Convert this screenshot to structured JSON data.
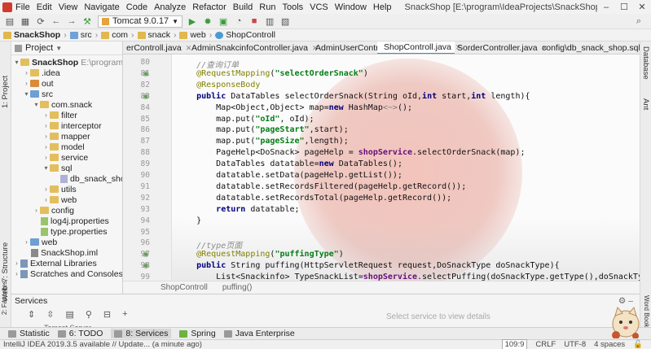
{
  "menubar": {
    "items": [
      "File",
      "Edit",
      "View",
      "Navigate",
      "Code",
      "Analyze",
      "Refactor",
      "Build",
      "Run",
      "Tools",
      "VCS",
      "Window",
      "Help"
    ],
    "title": "SnackShop [E:\\program\\IdeaProjects\\SnackShop] - ...\\src\\com\\snack\\web\\ShopControll.java"
  },
  "toolbar": {
    "run_config": "Tomcat 9.0.17"
  },
  "breadcrumb": [
    "SnackShop",
    "src",
    "com",
    "snack",
    "web",
    "ShopControll"
  ],
  "left_strip": {
    "project": "1: Project",
    "structure": "7: Structure",
    "web": "Web",
    "favorites": "2: Favorites"
  },
  "right_strip": {
    "database": "Database",
    "ant": "Ant",
    "word_book": "Word Book"
  },
  "project_panel": {
    "header": "Project",
    "tree": [
      {
        "label": "SnackShop",
        "suffix": "E:\\program\\IdeaProj"
      },
      {
        "label": ".idea"
      },
      {
        "label": "out"
      },
      {
        "label": "src"
      },
      {
        "label": "com.snack"
      },
      {
        "label": "filter"
      },
      {
        "label": "interceptor"
      },
      {
        "label": "mapper"
      },
      {
        "label": "model"
      },
      {
        "label": "service"
      },
      {
        "label": "sql"
      },
      {
        "label": "db_snack_shop.sql"
      },
      {
        "label": "utils"
      },
      {
        "label": "web"
      },
      {
        "label": "config"
      },
      {
        "label": "log4j.properties"
      },
      {
        "label": "type.properties"
      },
      {
        "label": "web"
      },
      {
        "label": "SnackShop.iml"
      },
      {
        "label": "External Libraries"
      },
      {
        "label": "Scratches and Consoles"
      }
    ]
  },
  "tabs": [
    {
      "label": "erControll.java"
    },
    {
      "label": "AdminSnakcinfoController.java"
    },
    {
      "label": "AdminUserControll.java"
    },
    {
      "label": "ShopControll.java"
    },
    {
      "label": "SorderController.java"
    },
    {
      "label": "config\\db_snack_shop.sql"
    }
  ],
  "editor": {
    "line_numbers": [
      "80",
      "81",
      "82",
      "83",
      "84",
      "85",
      "86",
      "87",
      "88",
      "89",
      "90",
      "91",
      "92",
      "93",
      "94",
      "95",
      "96",
      "97",
      "98",
      "99",
      "100"
    ],
    "code_lines": [
      "    //查询订单",
      "    @RequestMapping(\"selectOrderSnack\")",
      "    @ResponseBody",
      "    public DataTables selectOrderSnack(String oId,int start,int length){",
      "        Map<Object,Object> map=new HashMap<~>();",
      "        map.put(\"oId\", oId);",
      "        map.put(\"pageStart\",start);",
      "        map.put(\"pageSize\",length);",
      "        PageHelp<DoSnack> pageHelp = shopService.selectOrderSnack(map);",
      "        DataTables datatable=new DataTables();",
      "        datatable.setData(pageHelp.getList());",
      "        datatable.setRecordsFiltered(pageHelp.getRecord());",
      "        datatable.setRecordsTotal(pageHelp.getRecord());",
      "        return datatable;",
      "    }",
      "",
      "    //type页面",
      "    @RequestMapping(\"puffingType\")",
      "    public String puffing(HttpServletRequest request,DoSnackType doSnackType){",
      "        List<Snackinfo> TypeSnackList=shopService.selectPuffing(doSnackType.getType(),doSnackType.getSnackName());"
    ],
    "footer_crumbs": [
      "ShopControll",
      "puffing()"
    ]
  },
  "services": {
    "title": "Services",
    "hint": "Select service to view details",
    "server": "Tomcat Server"
  },
  "bottom_tabs": [
    {
      "label": "Statistic"
    },
    {
      "label": "6: TODO"
    },
    {
      "label": "8: Services"
    },
    {
      "label": "Spring"
    },
    {
      "label": "Java Enterprise"
    }
  ],
  "status": {
    "message": "IntelliJ IDEA 2019.3.5 available // Update... (a minute ago)",
    "position": "109:9",
    "line_sep": "CRLF",
    "encoding": "UTF-8",
    "indent": "4 spaces"
  },
  "colors": {
    "accent": "#4a88c7",
    "moon": "#e58c7d",
    "folder": "#e3be5c"
  }
}
